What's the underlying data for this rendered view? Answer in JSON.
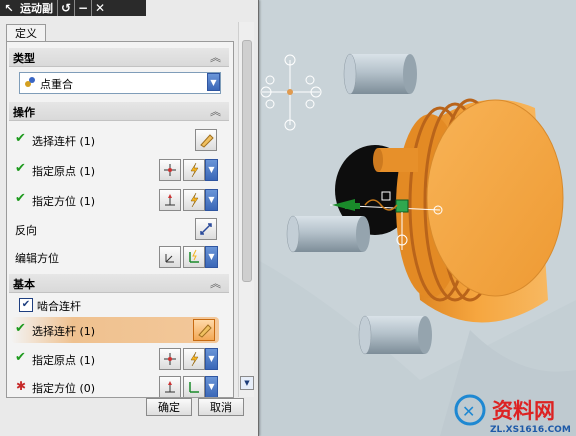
{
  "window": {
    "title": "运动副"
  },
  "tabs": [
    {
      "label": "定义"
    }
  ],
  "sections": {
    "type": {
      "header": "类型",
      "selected": "点重合"
    },
    "operation": {
      "header": "操作",
      "rows": [
        {
          "label": "选择连杆 (1)",
          "status": "done"
        },
        {
          "label": "指定原点 (1)",
          "status": "done"
        },
        {
          "label": "指定方位 (1)",
          "status": "done"
        },
        {
          "label": "反向"
        },
        {
          "label": "编辑方位"
        }
      ]
    },
    "base": {
      "header": "基本",
      "checkbox_label": "啮合连杆",
      "checkbox_checked": true,
      "rows": [
        {
          "label": "选择连杆 (1)",
          "status": "done",
          "active": true
        },
        {
          "label": "指定原点 (1)",
          "status": "done"
        },
        {
          "label": "指定方位 (0)",
          "status": "required"
        }
      ]
    }
  },
  "buttons": {
    "ok": "确定",
    "cancel": "取消"
  },
  "watermark": {
    "brand": "资料网",
    "url": "ZL.XS1616.COM"
  },
  "colors": {
    "check": "#1e9a1e",
    "required": "#c62828",
    "highlight": "#f0c79a",
    "model_orange": "#f2a03a",
    "cylinder": "#aab8c3"
  }
}
